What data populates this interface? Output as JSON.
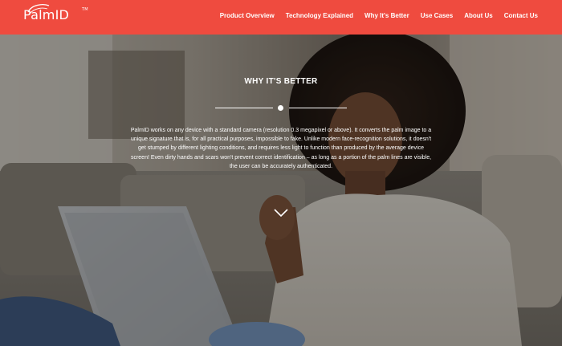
{
  "header": {
    "brand": "PalmID",
    "brand_mark": "TM",
    "background_color": "#ef4b3f",
    "nav": [
      {
        "label": "Product Overview"
      },
      {
        "label": "Technology Explained"
      },
      {
        "label": "Why It's Better"
      },
      {
        "label": "Use Cases"
      },
      {
        "label": "About Us"
      },
      {
        "label": "Contact Us"
      }
    ]
  },
  "hero": {
    "title": "WHY IT'S BETTER",
    "body": "PalmID works on any device with a standard camera (resolution 0.3 megapixel or above). It converts the palm image to a unique signature that is, for all practical purposes, impossible to fake. Unlike modern face-recognition solutions, it doesn't get stumped by different lighting conditions, and requires less light to function than produced by the average device screen! Even dirty hands and scars won't prevent correct identification – as long as a portion of the palm lines are visible, the user can be accurately authenticated.",
    "scroll_icon": "chevron-down-icon",
    "divider_icon": "dot-divider"
  }
}
